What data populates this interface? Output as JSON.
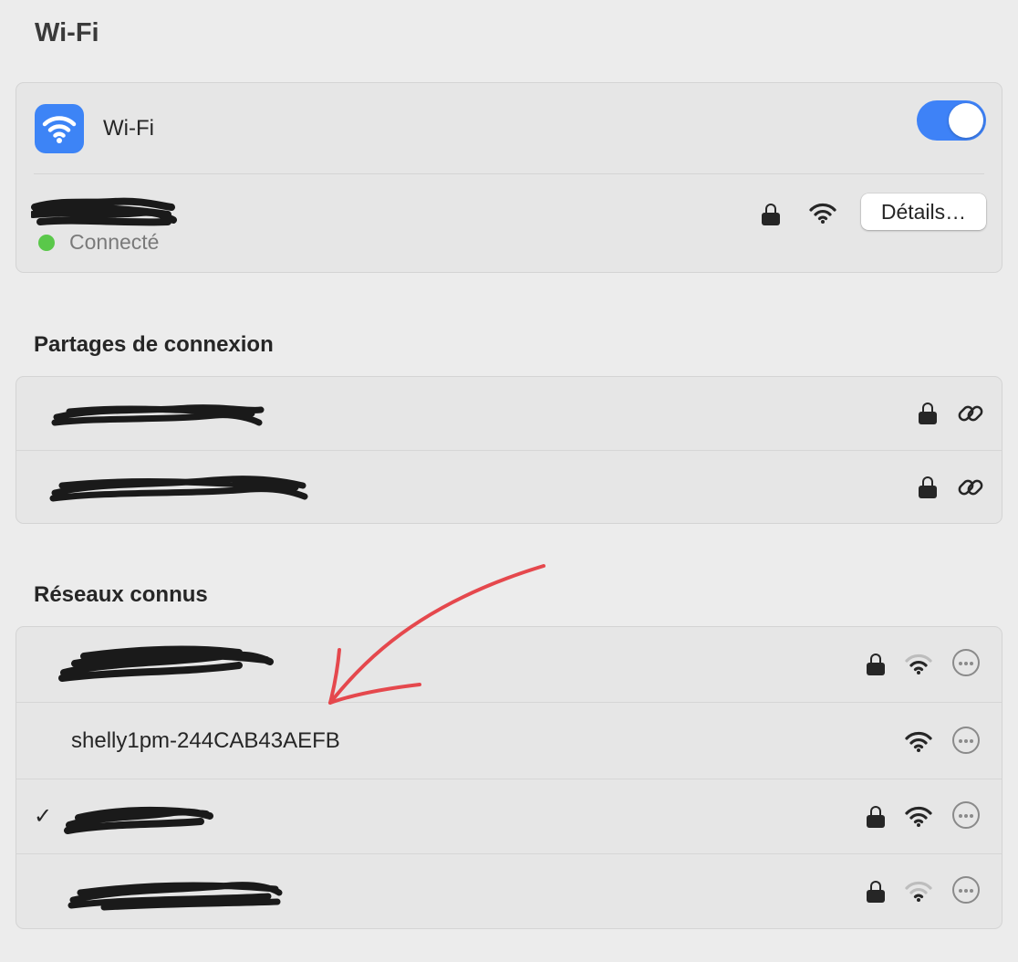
{
  "page": {
    "title": "Wi-Fi"
  },
  "wifi_card": {
    "label": "Wi-Fi",
    "toggle_on": true,
    "current_network": {
      "name": "",
      "status": "Connecté",
      "status_color": "#5ac84a",
      "secured": true,
      "details_label": "Détails…"
    }
  },
  "hotspots": {
    "title": "Partages de connexion",
    "items": [
      {
        "name": "",
        "secured": true,
        "icon": "link-icon"
      },
      {
        "name": "",
        "secured": true,
        "icon": "link-icon"
      }
    ]
  },
  "known_networks": {
    "title": "Réseaux connus",
    "items": [
      {
        "name": "",
        "secured": true,
        "signal": "weak",
        "connected": false
      },
      {
        "name": "shelly1pm-244CAB43AEFB",
        "secured": false,
        "signal": "strong",
        "connected": false
      },
      {
        "name": "",
        "secured": true,
        "signal": "strong",
        "connected": true
      },
      {
        "name": "",
        "secured": true,
        "signal": "weak",
        "connected": false
      }
    ]
  },
  "colors": {
    "accent": "#3e82f7",
    "background": "#ececec",
    "annotation_arrow": "#e5484d"
  },
  "check_glyph": "✓"
}
